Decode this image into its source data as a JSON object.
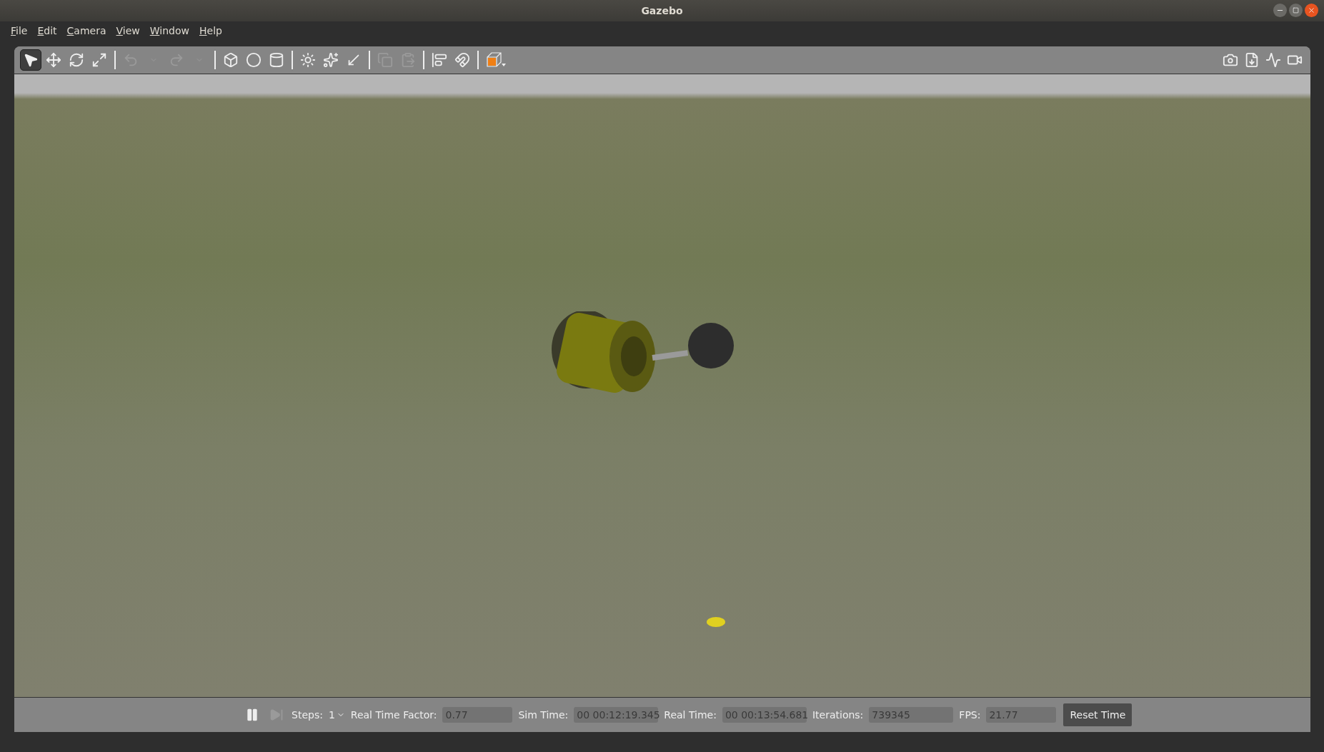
{
  "window": {
    "title": "Gazebo"
  },
  "menu": [
    {
      "label": "File"
    },
    {
      "label": "Edit"
    },
    {
      "label": "Camera"
    },
    {
      "label": "View"
    },
    {
      "label": "Window"
    },
    {
      "label": "Help"
    }
  ],
  "toolbar_left": [
    {
      "kind": "select",
      "selected": true,
      "disabled": false
    },
    {
      "kind": "translate",
      "selected": false,
      "disabled": false
    },
    {
      "kind": "rotate",
      "selected": false,
      "disabled": false
    },
    {
      "kind": "scale",
      "selected": false,
      "disabled": false
    },
    {
      "kind": "separator"
    },
    {
      "kind": "undo",
      "selected": false,
      "disabled": true
    },
    {
      "kind": "caret",
      "selected": false,
      "disabled": true
    },
    {
      "kind": "redo",
      "selected": false,
      "disabled": true
    },
    {
      "kind": "caret",
      "selected": false,
      "disabled": true
    },
    {
      "kind": "separator"
    },
    {
      "kind": "box",
      "selected": false,
      "disabled": false
    },
    {
      "kind": "sphere",
      "selected": false,
      "disabled": false
    },
    {
      "kind": "cylinder",
      "selected": false,
      "disabled": false
    },
    {
      "kind": "separator"
    },
    {
      "kind": "point_light",
      "selected": false,
      "disabled": false
    },
    {
      "kind": "spot_light",
      "selected": false,
      "disabled": false
    },
    {
      "kind": "directional_light",
      "selected": false,
      "disabled": false
    },
    {
      "kind": "separator"
    },
    {
      "kind": "copy",
      "selected": false,
      "disabled": true
    },
    {
      "kind": "paste",
      "selected": false,
      "disabled": true
    },
    {
      "kind": "separator"
    },
    {
      "kind": "align",
      "selected": false,
      "disabled": false
    },
    {
      "kind": "snap",
      "selected": false,
      "disabled": false
    },
    {
      "kind": "separator"
    },
    {
      "kind": "view_angle",
      "selected": false,
      "disabled": false
    }
  ],
  "toolbar_right": [
    {
      "kind": "screenshot"
    },
    {
      "kind": "log"
    },
    {
      "kind": "plot"
    },
    {
      "kind": "record"
    }
  ],
  "bottom_bar": {
    "steps_label": "Steps:",
    "steps_value": "1",
    "fields": [
      {
        "label": "Real Time Factor:",
        "value": "0.77"
      },
      {
        "label": "Sim Time:",
        "value": "00 00:12:19.345"
      },
      {
        "label": "Real Time:",
        "value": "00 00:13:54.681"
      },
      {
        "label": "Iterations:",
        "value": "739345"
      },
      {
        "label": "FPS:",
        "value": "21.77"
      }
    ],
    "reset_button": "Reset Time"
  }
}
